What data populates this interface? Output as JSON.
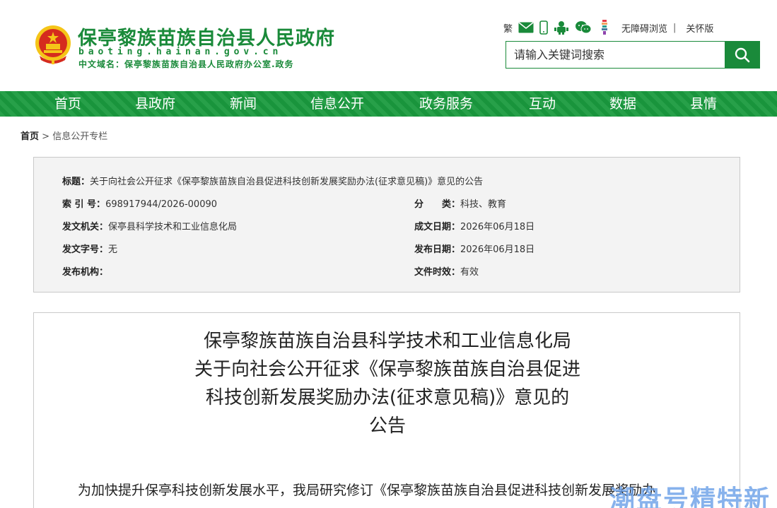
{
  "header": {
    "site_title": "保亭黎族苗族自治县人民政府",
    "site_domain": "baoting.hainan.gov.cn",
    "cn_domain": "中文域名：保亭黎族苗族自治县人民政府办公室.政务",
    "tools": {
      "traditional": "繁",
      "accessibility": "无障碍浏览",
      "separator": "|",
      "elderly": "关怀版"
    },
    "search": {
      "placeholder": "请输入关键词搜索"
    }
  },
  "nav": {
    "items": [
      {
        "label": "首页"
      },
      {
        "label": "县政府"
      },
      {
        "label": "新闻"
      },
      {
        "label": "信息公开"
      },
      {
        "label": "政务服务"
      },
      {
        "label": "互动"
      },
      {
        "label": "数据"
      },
      {
        "label": "县情"
      }
    ]
  },
  "breadcrumb": {
    "home": "首页",
    "sep": ">",
    "current": "信息公开专栏"
  },
  "info": {
    "title_label": "标题：",
    "title_value": "关于向社会公开征求《保亭黎族苗族自治县促进科技创新发展奖励办法(征求意见稿)》意见的公告",
    "index_label": "索 引 号：",
    "index_value": "698917944/2026-00090",
    "category_label": "分　　类：",
    "category_value": "科技、教育",
    "issuer_label": "发文机关：",
    "issuer_value": "保亭县科学技术和工业信息化局",
    "created_label": "成文日期：",
    "created_value": "2026年06月18日",
    "docno_label": "发文字号：",
    "docno_value": "无",
    "published_label": "发布日期：",
    "published_value": "2026年06月18日",
    "agency_label": "发布机构：",
    "agency_value": "",
    "validity_label": "文件时效：",
    "validity_value": "有效"
  },
  "article": {
    "title_lines": [
      "保亭黎族苗族自治县科学技术和工业信息化局",
      "关于向社会公开征求《保亭黎族苗族自治县促进",
      "科技创新发展奖励办法(征求意见稿)》意见的",
      "公告"
    ],
    "body_first_line": "为加快提升保亭科技创新发展水平，我局研究修订《保亭黎族苗族自治县促进科技创新发展奖励办"
  },
  "watermark": "潮盘号精特新",
  "colors": {
    "brand_green": "#1a8a3a",
    "nav_green": "#1a9a3e",
    "emblem_red": "#d52b1e",
    "emblem_gold": "#f5c518"
  }
}
